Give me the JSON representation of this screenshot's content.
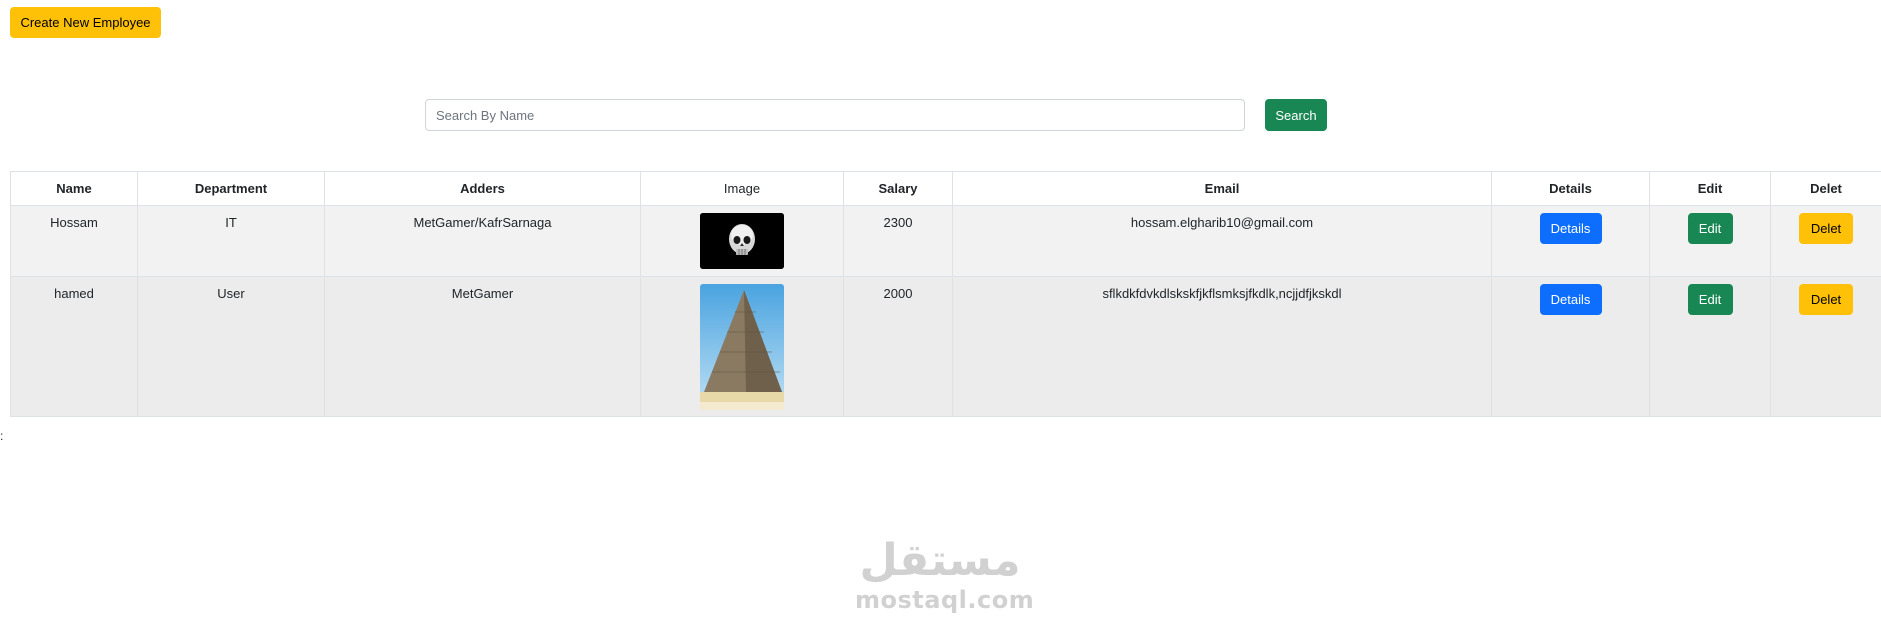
{
  "toolbar": {
    "create_label": "Create New Employee"
  },
  "search": {
    "placeholder": "Search By Name",
    "value": "",
    "button_label": "Search"
  },
  "table": {
    "headers": {
      "name": "Name",
      "department": "Department",
      "address": "Adders",
      "image": "Image",
      "salary": "Salary",
      "email": "Email",
      "details": "Details",
      "edit": "Edit",
      "delete": "Delet"
    },
    "rows": [
      {
        "name": "Hossam",
        "department": "IT",
        "address": "MetGamer/KafrSarnaga",
        "image_icon": "skull-photo",
        "salary": "2300",
        "email": "hossam.elgharib10@gmail.com",
        "details_label": "Details",
        "edit_label": "Edit",
        "delete_label": "Delet"
      },
      {
        "name": "hamed",
        "department": "User",
        "address": "MetGamer",
        "image_icon": "pyramid-photo",
        "salary": "2000",
        "email": "sflkdkfdvkdlskskfjkflsmksjfkdlk,ncjjdfjkskdl",
        "details_label": "Details",
        "edit_label": "Edit",
        "delete_label": "Delet"
      }
    ]
  },
  "stray_text": ":",
  "watermark": {
    "arabic": "مستقل",
    "latin": "mostaql.com"
  },
  "colors": {
    "warning": "#ffc107",
    "success": "#198754",
    "primary": "#0d6efd",
    "row_stripe": "#f2f2f2",
    "row_alt": "#ececec",
    "border": "#dee2e6"
  }
}
